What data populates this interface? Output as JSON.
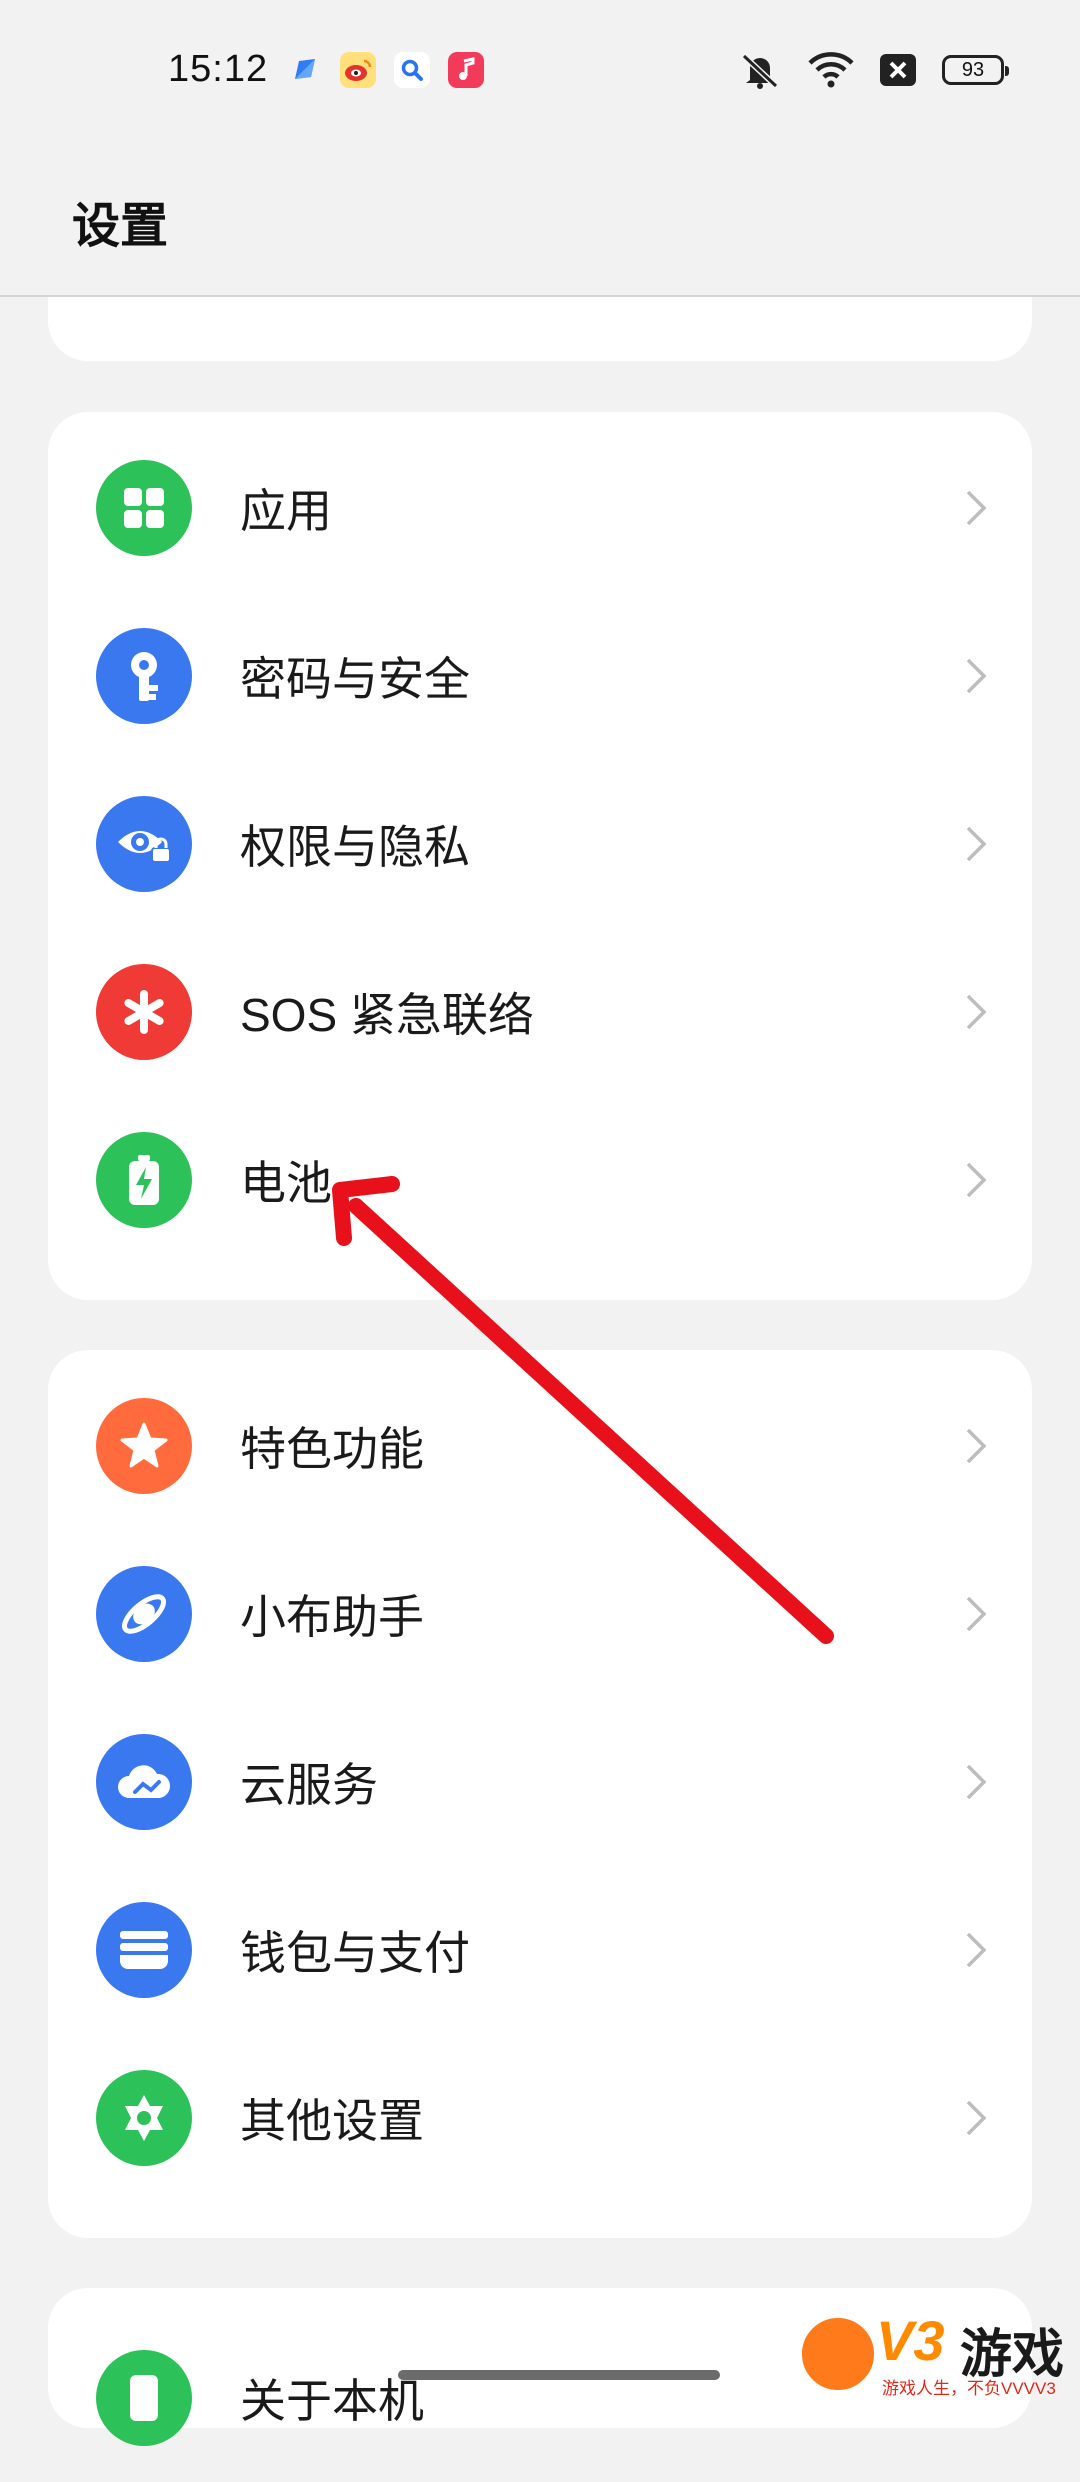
{
  "status_bar": {
    "time": "15:12",
    "battery_level": "93",
    "notification_icons": [
      "app-icon",
      "weibo-icon",
      "search-app-icon",
      "music-icon"
    ],
    "system_icons": [
      "mute-icon",
      "wifi-icon",
      "no-sim-icon",
      "battery-icon"
    ]
  },
  "header": {
    "title": "设置"
  },
  "groups": [
    {
      "items": [
        {
          "label": "应用",
          "icon": "apps-icon",
          "color": "#2dc15a"
        },
        {
          "label": "密码与安全",
          "icon": "key-icon",
          "color": "#3a78f0"
        },
        {
          "label": "权限与隐私",
          "icon": "privacy-eye-icon",
          "color": "#3a78f0"
        },
        {
          "label": "SOS 紧急联络",
          "icon": "sos-asterisk-icon",
          "color": "#ef3a35"
        },
        {
          "label": "电池",
          "icon": "battery-charging-icon",
          "color": "#2dc15a"
        }
      ]
    },
    {
      "items": [
        {
          "label": "特色功能",
          "icon": "star-icon",
          "color": "#ff6b3d"
        },
        {
          "label": "小布助手",
          "icon": "assistant-icon",
          "color": "#3a78f0"
        },
        {
          "label": "云服务",
          "icon": "cloud-icon",
          "color": "#3a78f0"
        },
        {
          "label": "钱包与支付",
          "icon": "wallet-icon",
          "color": "#3a78f0"
        },
        {
          "label": "其他设置",
          "icon": "gear-icon",
          "color": "#2dc15a"
        }
      ]
    },
    {
      "items": [
        {
          "label": "关于本机",
          "icon": "phone-icon",
          "color": "#2dc15a"
        }
      ]
    }
  ],
  "watermark": {
    "brand": "V3",
    "name": "游戏",
    "slogan": "游戏人生，不负VVVV3"
  },
  "annotation_color": "#e8101a"
}
